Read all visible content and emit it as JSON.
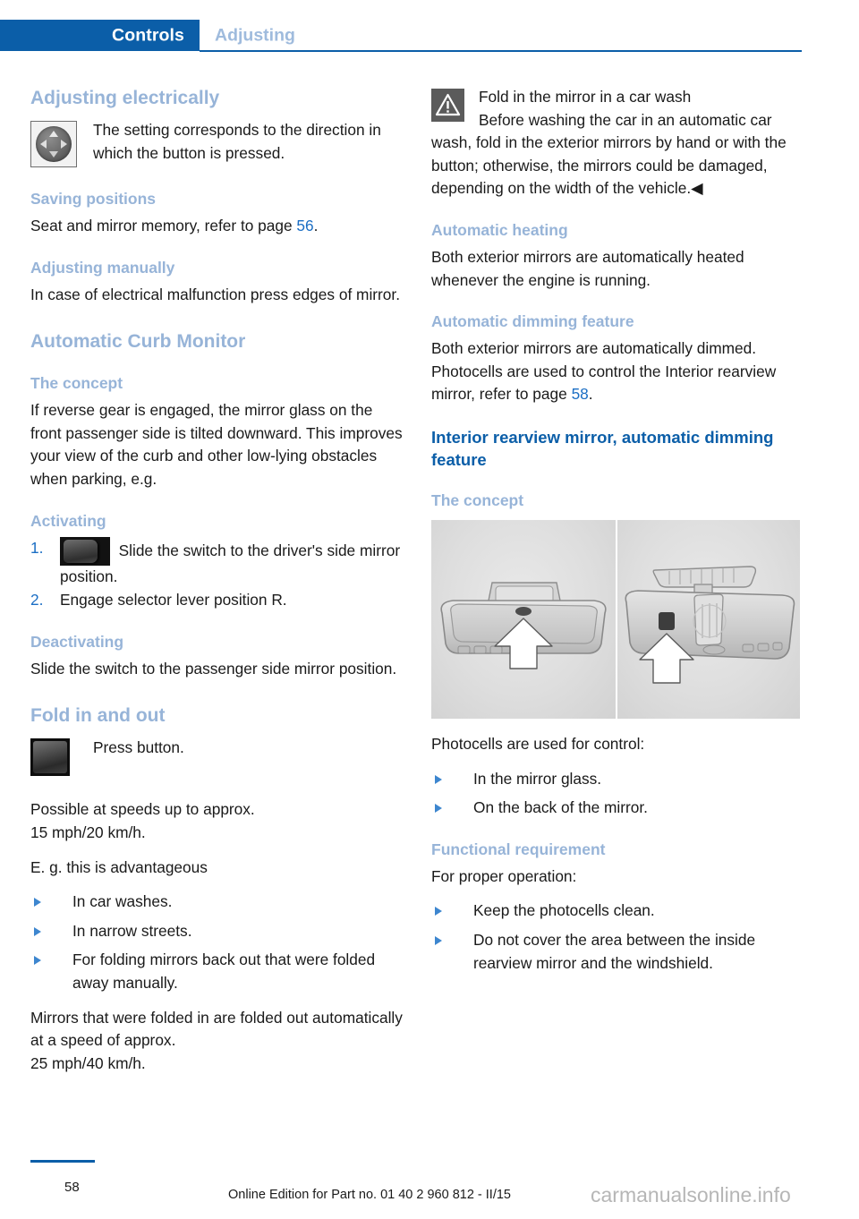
{
  "header": {
    "tab_label": "Controls",
    "section_label": "Adjusting",
    "accent_color": "#0b5ea8"
  },
  "left_column": {
    "h_adjusting_electrically": "Adjusting electrically",
    "p_setting_corresponds": "The setting corresponds to the direction in which the button is pressed.",
    "h_saving_positions": "Saving positions",
    "p_seat_mirror_memory_pre": "Seat and mirror memory, refer to page ",
    "p_seat_mirror_memory_ref": "56",
    "p_seat_mirror_memory_post": ".",
    "h_adjusting_manually": "Adjusting manually",
    "p_electrical_malfunction": "In case of electrical malfunction press edges of mirror.",
    "h_automatic_curb_monitor": "Automatic Curb Monitor",
    "h_the_concept": "The concept",
    "p_reverse_gear": "If reverse gear is engaged, the mirror glass on the front passenger side is tilted downward. This improves your view of the curb and other low-lying obstacles when parking, e.g.",
    "h_activating": "Activating",
    "steps": [
      {
        "num": "1.",
        "text": "Slide the switch to the driver's side mirror position.",
        "has_icon": true
      },
      {
        "num": "2.",
        "text": "Engage selector lever position R.",
        "has_icon": false
      }
    ],
    "h_deactivating": "Deactivating",
    "p_slide_switch_passenger": "Slide the switch to the passenger side mirror position.",
    "h_fold_in_and_out": "Fold in and out",
    "p_press_button": "Press button.",
    "p_possible_speeds": "Possible at speeds up to approx.\n15 mph/20 km/h.",
    "p_eg_advantageous": "E. g. this is advantageous",
    "bullets_advantageous": [
      "In car washes.",
      "In narrow streets.",
      "For folding mirrors back out that were folded away manually."
    ],
    "p_mirrors_folded_out": "Mirrors that were folded in are folded out automatically at a speed of approx.\n25 mph/40 km/h."
  },
  "right_column": {
    "warning": {
      "icon": "warning-triangle-icon",
      "title": "Fold in the mirror in a car wash",
      "body": "Before washing the car in an automatic car wash, fold in the exterior mirrors by hand or with the button; otherwise, the mirrors could be damaged, depending on the width of the vehicle.◀"
    },
    "h_automatic_heating": "Automatic heating",
    "p_automatic_heating": "Both exterior mirrors are automatically heated whenever the engine is running.",
    "h_automatic_dimming": "Automatic dimming feature",
    "p_automatic_dimming_pre": "Both exterior mirrors are automatically dimmed. Photocells are used to control the Interior rearview mirror, refer to page ",
    "p_automatic_dimming_ref": "58",
    "p_automatic_dimming_post": ".",
    "h_interior_rearview": "Interior rearview mirror, automatic dimming feature",
    "h_the_concept": "The concept",
    "figure_caption_alt": "Interior rearview mirror front view and back view with photocell locations",
    "p_photocells_control": "Photocells are used for control:",
    "bullets_photocells": [
      "In the mirror glass.",
      "On the back of the mirror."
    ],
    "h_functional_requirement": "Functional requirement",
    "p_for_proper_operation": "For proper operation:",
    "bullets_requirement": [
      "Keep the photocells clean.",
      "Do not cover the area between the inside rearview mirror and the windshield."
    ]
  },
  "footer": {
    "page_number": "58",
    "edition": "Online Edition for Part no. 01 40 2 960 812 - II/15",
    "watermark": "carmanualsonline.info"
  }
}
